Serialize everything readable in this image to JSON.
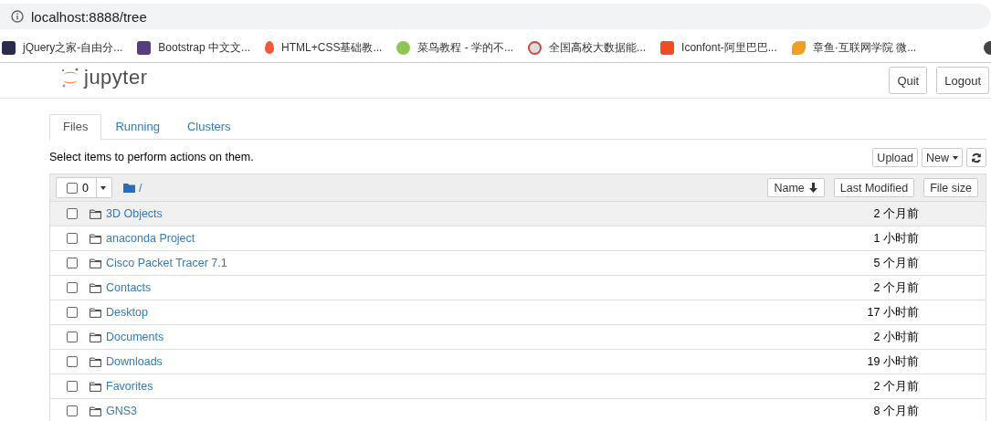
{
  "browser": {
    "address": "localhost:8888/tree",
    "bookmarks": [
      {
        "label": "jQuery之家-自由分..."
      },
      {
        "label": "Bootstrap 中文文..."
      },
      {
        "label": "HTML+CSS基础教..."
      },
      {
        "label": "菜鸟教程 - 学的不..."
      },
      {
        "label": "全国高校大数据能..."
      },
      {
        "label": "Iconfont-阿里巴巴..."
      },
      {
        "label": "章鱼·互联网学院 微..."
      }
    ]
  },
  "header": {
    "logo": "jupyter",
    "buttons": [
      "Quit",
      "Logout"
    ]
  },
  "tabs": [
    {
      "label": "Files",
      "selected": true
    },
    {
      "label": "Running",
      "selected": false
    },
    {
      "label": "Clusters",
      "selected": false
    }
  ],
  "hint": "Select items to perform actions on them.",
  "toolbar": {
    "upload": "Upload",
    "new": "New"
  },
  "list_header": {
    "selected_count": "0",
    "path": "/",
    "sort_buttons": [
      "Name",
      "Last Modified",
      "File size"
    ]
  },
  "rows": [
    {
      "name": "3D Objects",
      "modified": "2 个月前",
      "checked": false,
      "highlighted": true
    },
    {
      "name": "anaconda Project",
      "modified": "1 小时前",
      "checked": false,
      "highlighted": false
    },
    {
      "name": "Cisco Packet Tracer 7.1",
      "modified": "5 个月前",
      "checked": false,
      "highlighted": false
    },
    {
      "name": "Contacts",
      "modified": "2 个月前",
      "checked": false,
      "highlighted": false
    },
    {
      "name": "Desktop",
      "modified": "17 小时前",
      "checked": false,
      "highlighted": false
    },
    {
      "name": "Documents",
      "modified": "2 小时前",
      "checked": false,
      "highlighted": false
    },
    {
      "name": "Downloads",
      "modified": "19 小时前",
      "checked": false,
      "highlighted": false
    },
    {
      "name": "Favorites",
      "modified": "2 个月前",
      "checked": false,
      "highlighted": false
    },
    {
      "name": "GNS3",
      "modified": "8 个月前",
      "checked": false,
      "highlighted": false
    }
  ]
}
